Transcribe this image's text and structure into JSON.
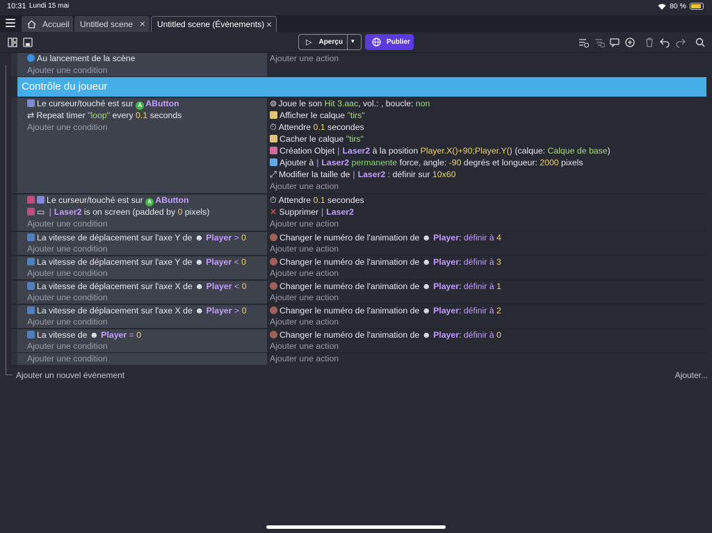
{
  "status": {
    "time": "10:31",
    "date": "Lundi 15 mai",
    "battery": "80 %"
  },
  "tabs": [
    {
      "label": "Accueil"
    },
    {
      "label": "Untitled scene"
    },
    {
      "label": "Untitled scene (Évènements)"
    }
  ],
  "toolbar": {
    "apercu": "Aperçu",
    "publier": "Publier"
  },
  "placeholders": {
    "condition": "Ajouter une condition",
    "action": "Ajouter une action"
  },
  "group_title": "Contrôle du joueur",
  "footer": {
    "add_event": "Ajouter un nouvel évènement",
    "add_more": "Ajouter..."
  },
  "events": {
    "e0": {
      "c1": "Au lancement de la scène"
    },
    "e1": {
      "c1_text": "Le curseur/touché est sur",
      "c1_obj": "AButton",
      "c2_pre": "Repeat timer",
      "c2_str": "\"loop\"",
      "c2_mid": "every",
      "c2_num": "0.1",
      "c2_post": "seconds",
      "a1_pre": "Joue le son",
      "a1_str": "Hit 3.aac",
      "a1_mid": ", vol.: , boucle:",
      "a1_kw": "non",
      "a2_pre": "Afficher le calque",
      "a2_str": "\"tirs\"",
      "a3_pre": "Attendre",
      "a3_num": "0.1",
      "a3_post": "secondes",
      "a4_pre": "Cacher le calque",
      "a4_str": "\"tirs\"",
      "a5_pre": "Création Objet",
      "a5_obj": "Laser2",
      "a5_mid": "à la position",
      "a5_num": "Player.X()+90;Player.Y()",
      "a5_mid2": "(calque:",
      "a5_str": "Calque de base",
      "a5_post": ")",
      "a6_pre": "Ajouter à",
      "a6_obj": "Laser2",
      "a6_grn": "permanente",
      "a6_mid": "force, angle:",
      "a6_num1": "-90",
      "a6_mid2": "degrés et longueur:",
      "a6_num2": "2000",
      "a6_post": "pixels",
      "a7_pre": "Modifier la taille de",
      "a7_obj": "Laser2",
      "a7_mid": ": définir sur",
      "a7_num": "10x60"
    },
    "e2": {
      "c1_text": "Le curseur/touché est sur",
      "c1_obj": "AButton",
      "c2_obj": "Laser2",
      "c2_mid": "is on screen (padded by",
      "c2_num": "0",
      "c2_post": "pixels)",
      "a1_pre": "Attendre",
      "a1_num": "0.1",
      "a1_post": "secondes",
      "a2_pre": "Supprimer",
      "a2_obj": "Laser2"
    },
    "anim": [
      {
        "cond_pre": "La vitesse de déplacement sur l'axe Y de",
        "obj": "Player",
        "op": ">",
        "val": "0",
        "act_pre": "Changer le numéro de l'animation de",
        "act_kw": "définir à",
        "act_val": "4"
      },
      {
        "cond_pre": "La vitesse de déplacement sur l'axe Y de",
        "obj": "Player",
        "op": "<",
        "val": "0",
        "act_pre": "Changer le numéro de l'animation de",
        "act_kw": "définir à",
        "act_val": "3"
      },
      {
        "cond_pre": "La vitesse de déplacement sur l'axe X de",
        "obj": "Player",
        "op": "<",
        "val": "0",
        "act_pre": "Changer le numéro de l'animation de",
        "act_kw": "définir à",
        "act_val": "1"
      },
      {
        "cond_pre": "La vitesse de déplacement sur l'axe X de",
        "obj": "Player",
        "op": ">",
        "val": "0",
        "act_pre": "Changer le numéro de l'animation de",
        "act_kw": "définir à",
        "act_val": "2"
      },
      {
        "cond_pre": "La vitesse de",
        "obj": "Player",
        "op": "=",
        "val": "0",
        "act_pre": "Changer le numéro de l'animation de",
        "act_kw": "définir à",
        "act_val": "0"
      }
    ]
  },
  "colors": {
    "group": "#46aee6",
    "publier": "#5b3ae0",
    "object": "#c59cff",
    "string": "#a7dc7d",
    "number": "#f2d16b"
  }
}
